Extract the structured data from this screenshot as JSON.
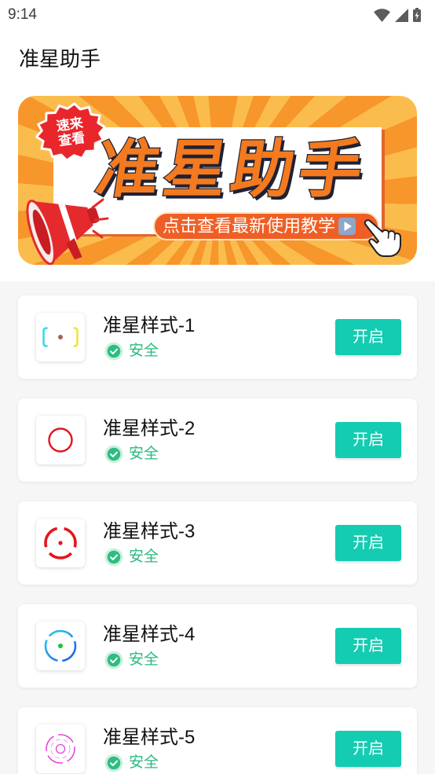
{
  "status_bar": {
    "time": "9:14",
    "icons": [
      "wifi-icon",
      "cell-signal-icon",
      "battery-charging-icon"
    ]
  },
  "app_bar": {
    "title": "准星助手"
  },
  "banner": {
    "badge_line1": "速来",
    "badge_line2": "查看",
    "headline": "准星助手",
    "cta_text": "点击查看最新使用教学",
    "icons": [
      "starburst-badge-icon",
      "megaphone-icon",
      "play-button-icon",
      "pointing-hand-icon"
    ]
  },
  "crosshair_list": {
    "items": [
      {
        "name": "准星样式-1",
        "icon": "crosshair-brackets-icon",
        "status": "安全",
        "status_icon": "verified-shield-icon",
        "action": "开启"
      },
      {
        "name": "准星样式-2",
        "icon": "crosshair-red-circle-icon",
        "status": "安全",
        "status_icon": "verified-shield-icon",
        "action": "开启"
      },
      {
        "name": "准星样式-3",
        "icon": "crosshair-red-broken-ring-icon",
        "status": "安全",
        "status_icon": "verified-shield-icon",
        "action": "开启"
      },
      {
        "name": "准星样式-4",
        "icon": "crosshair-blue-broken-ring-icon",
        "status": "安全",
        "status_icon": "verified-shield-icon",
        "action": "开启"
      },
      {
        "name": "准星样式-5",
        "icon": "crosshair-pink-dashed-ring-icon",
        "status": "安全",
        "status_icon": "verified-shield-icon",
        "action": "开启"
      }
    ]
  },
  "colors": {
    "accent_button": "#14CCB1",
    "safe_green": "#27BB7C",
    "banner_orange": "#F7962A",
    "banner_yellow": "#FBBC4E",
    "headline_orange": "#F47A1F",
    "badge_red": "#E8262B",
    "list_background": "#F6F6F6"
  }
}
